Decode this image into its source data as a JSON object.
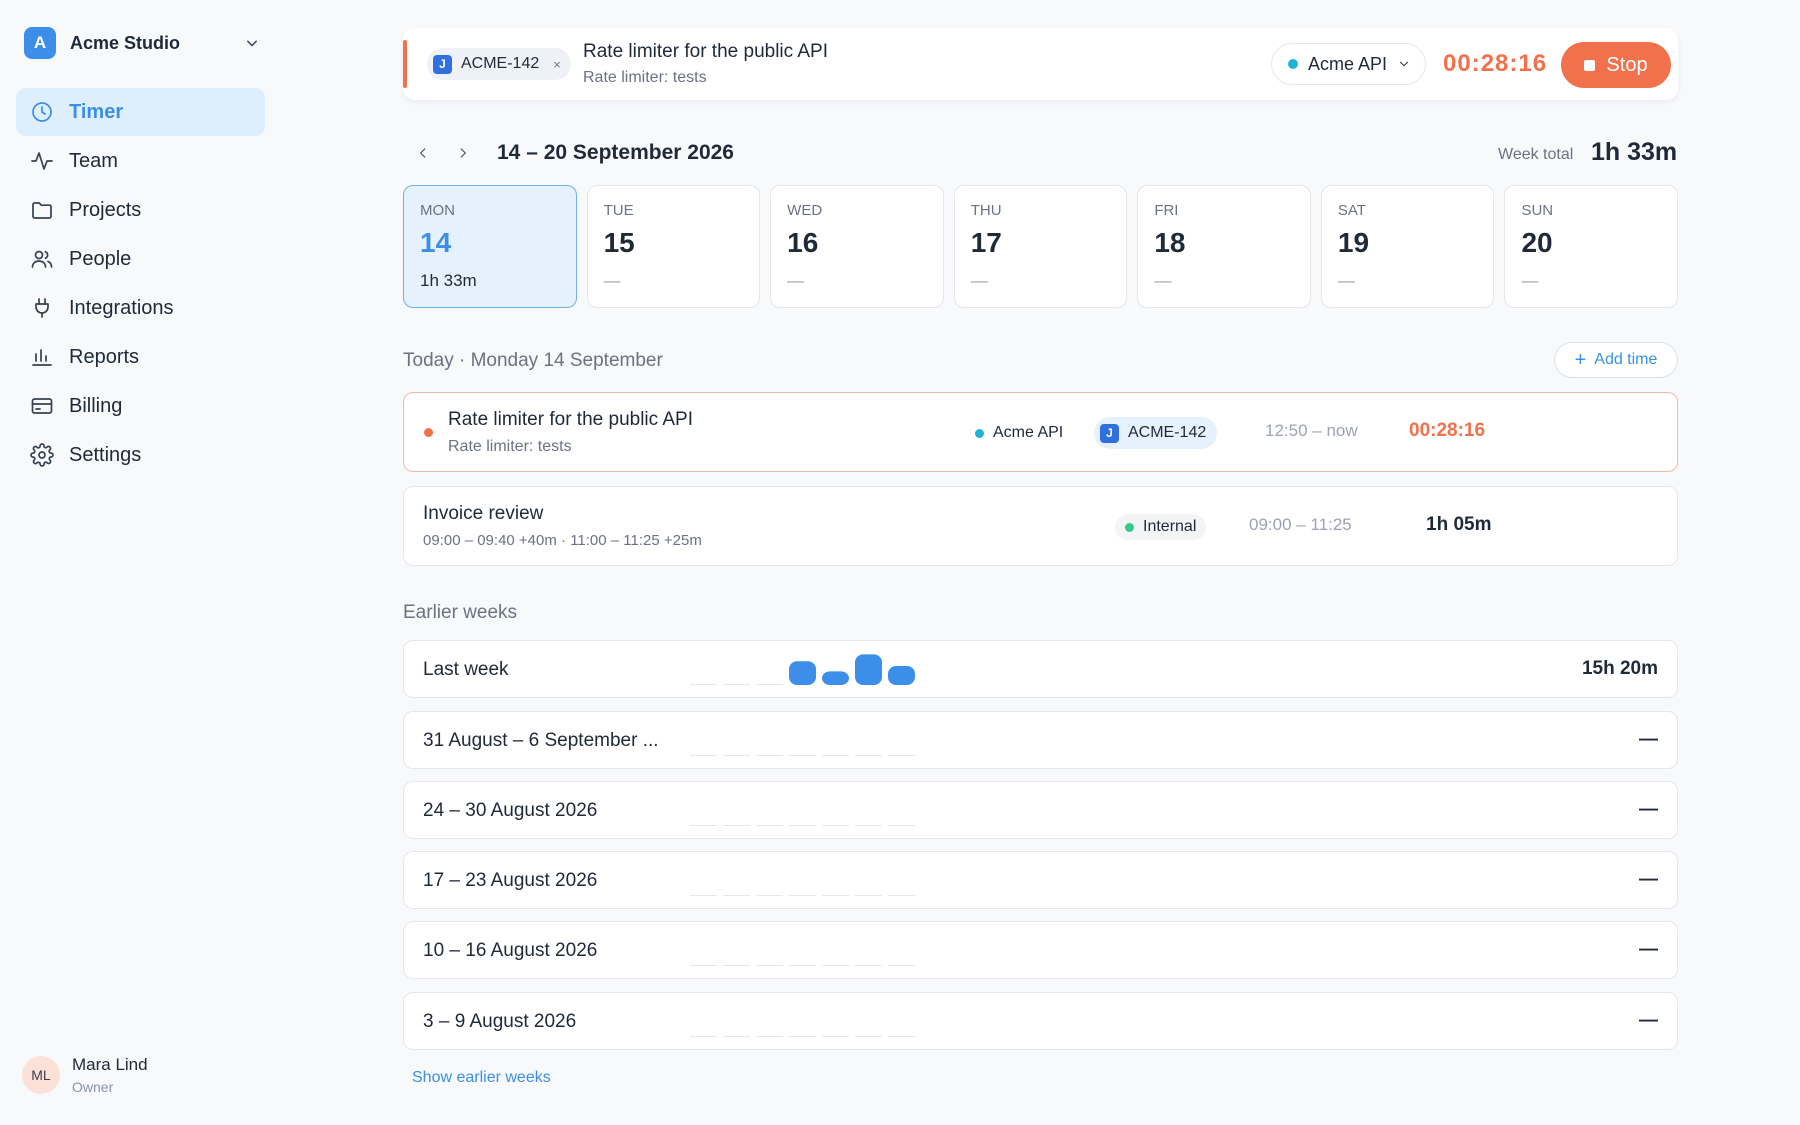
{
  "workspace": {
    "initial": "A",
    "name": "Acme Studio"
  },
  "nav": [
    {
      "key": "timer",
      "label": "Timer",
      "icon": "clock-icon",
      "active": true
    },
    {
      "key": "team",
      "label": "Team",
      "icon": "activity-icon"
    },
    {
      "key": "projects",
      "label": "Projects",
      "icon": "folder-icon"
    },
    {
      "key": "people",
      "label": "People",
      "icon": "users-icon"
    },
    {
      "key": "integrations",
      "label": "Integrations",
      "icon": "plug-icon"
    },
    {
      "key": "reports",
      "label": "Reports",
      "icon": "bar-chart-icon"
    },
    {
      "key": "billing",
      "label": "Billing",
      "icon": "credit-card-icon"
    },
    {
      "key": "settings",
      "label": "Settings",
      "icon": "gear-icon"
    }
  ],
  "user": {
    "initials": "ML",
    "name": "Mara Lind",
    "role": "Owner"
  },
  "timer": {
    "issue_badge": "J",
    "issue_key": "ACME-142",
    "remove_symbol": "×",
    "title": "Rate limiter for the public API",
    "subtitle": "Rate limiter: tests",
    "project": "Acme API",
    "project_color": "#1fb2d6",
    "elapsed": "00:28:16",
    "stop_label": "Stop"
  },
  "week": {
    "range": "14 – 20 September 2026",
    "total_label": "Week total",
    "total": "1h 33m",
    "days": [
      {
        "name": "MON",
        "date": "14",
        "total": "1h 33m",
        "selected": true
      },
      {
        "name": "TUE",
        "date": "15",
        "total": "—"
      },
      {
        "name": "WED",
        "date": "16",
        "total": "—"
      },
      {
        "name": "THU",
        "date": "17",
        "total": "—"
      },
      {
        "name": "FRI",
        "date": "18",
        "total": "—"
      },
      {
        "name": "SAT",
        "date": "19",
        "total": "—"
      },
      {
        "name": "SUN",
        "date": "20",
        "total": "—"
      }
    ]
  },
  "today": {
    "label": "Today · Monday 14 September",
    "add_label": "Add time",
    "add_symbol": "+",
    "entries": [
      {
        "title": "Rate limiter for the public API",
        "subtitle": "Rate limiter: tests",
        "project": "Acme API",
        "project_color": "#1fb2d6",
        "issue_badge": "J",
        "issue_key": "ACME-142",
        "time": "12:50 – now",
        "duration": "00:28:16",
        "running": true
      },
      {
        "title": "Invoice review",
        "subtitle": "09:00 – 09:40 +40m · 11:00 – 11:25 +25m",
        "project": "Internal",
        "project_color": "#34c88a",
        "time": "09:00 – 11:25",
        "duration": "1h 05m",
        "running": false
      }
    ]
  },
  "earlier": {
    "label": "Earlier weeks",
    "weeks": [
      {
        "label": "Last week",
        "total": "15h 20m",
        "daily_hours": [
          0,
          0,
          0,
          3.5,
          2.0,
          4.5,
          2.8
        ]
      },
      {
        "label": "31 August – 6 September ...",
        "total": "—",
        "daily_hours": [
          0,
          0,
          0,
          0,
          0,
          0,
          0
        ]
      },
      {
        "label": "24 – 30 August 2026",
        "total": "—",
        "daily_hours": [
          0,
          0,
          0,
          0,
          0,
          0,
          0
        ]
      },
      {
        "label": "17 – 23 August 2026",
        "total": "—",
        "daily_hours": [
          0,
          0,
          0,
          0,
          0,
          0,
          0
        ]
      },
      {
        "label": "10 – 16 August 2026",
        "total": "—",
        "daily_hours": [
          0,
          0,
          0,
          0,
          0,
          0,
          0
        ]
      },
      {
        "label": "3 – 9 August 2026",
        "total": "—",
        "daily_hours": [
          0,
          0,
          0,
          0,
          0,
          0,
          0
        ]
      }
    ],
    "show_more_label": "Show earlier weeks"
  },
  "colors": {
    "accent": "#3b8fe8",
    "running": "#f2714d",
    "bar": "#3d8ee8"
  }
}
